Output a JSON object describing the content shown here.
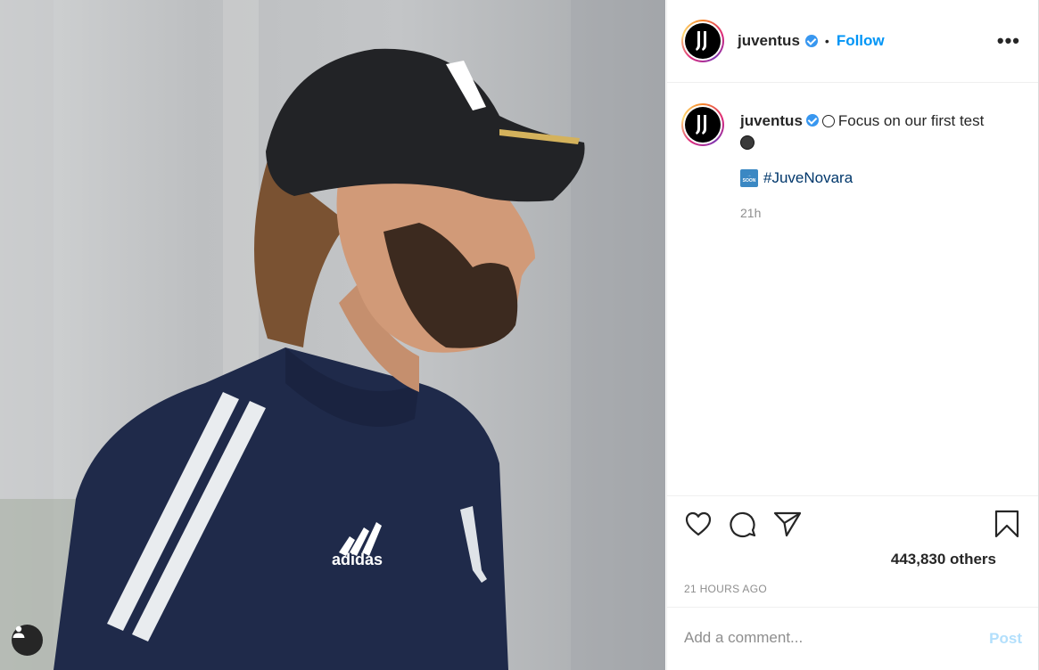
{
  "post": {
    "username": "juventus",
    "follow_label": "Follow",
    "separator": "•",
    "more_label": "•••",
    "caption_text": "Focus on our first test",
    "soon_emoji_text": "SOON",
    "hashtag": "#JuveNovara",
    "caption_time": "21h",
    "likes_text": "443,830 others",
    "timestamp": "21 HOURS AGO",
    "comment_placeholder": "Add a comment...",
    "post_label": "Post",
    "shirt_brand": "adidas"
  },
  "colors": {
    "follow": "#0095f6",
    "hashtag": "#00376b",
    "post_disabled": "#b2dffc",
    "muted": "#8e8e8e"
  },
  "icons": {
    "like": "heart-icon",
    "comment": "comment-icon",
    "share": "paper-plane-icon",
    "save": "bookmark-icon",
    "tag": "user-tag-icon",
    "verified": "verified-badge-icon"
  }
}
